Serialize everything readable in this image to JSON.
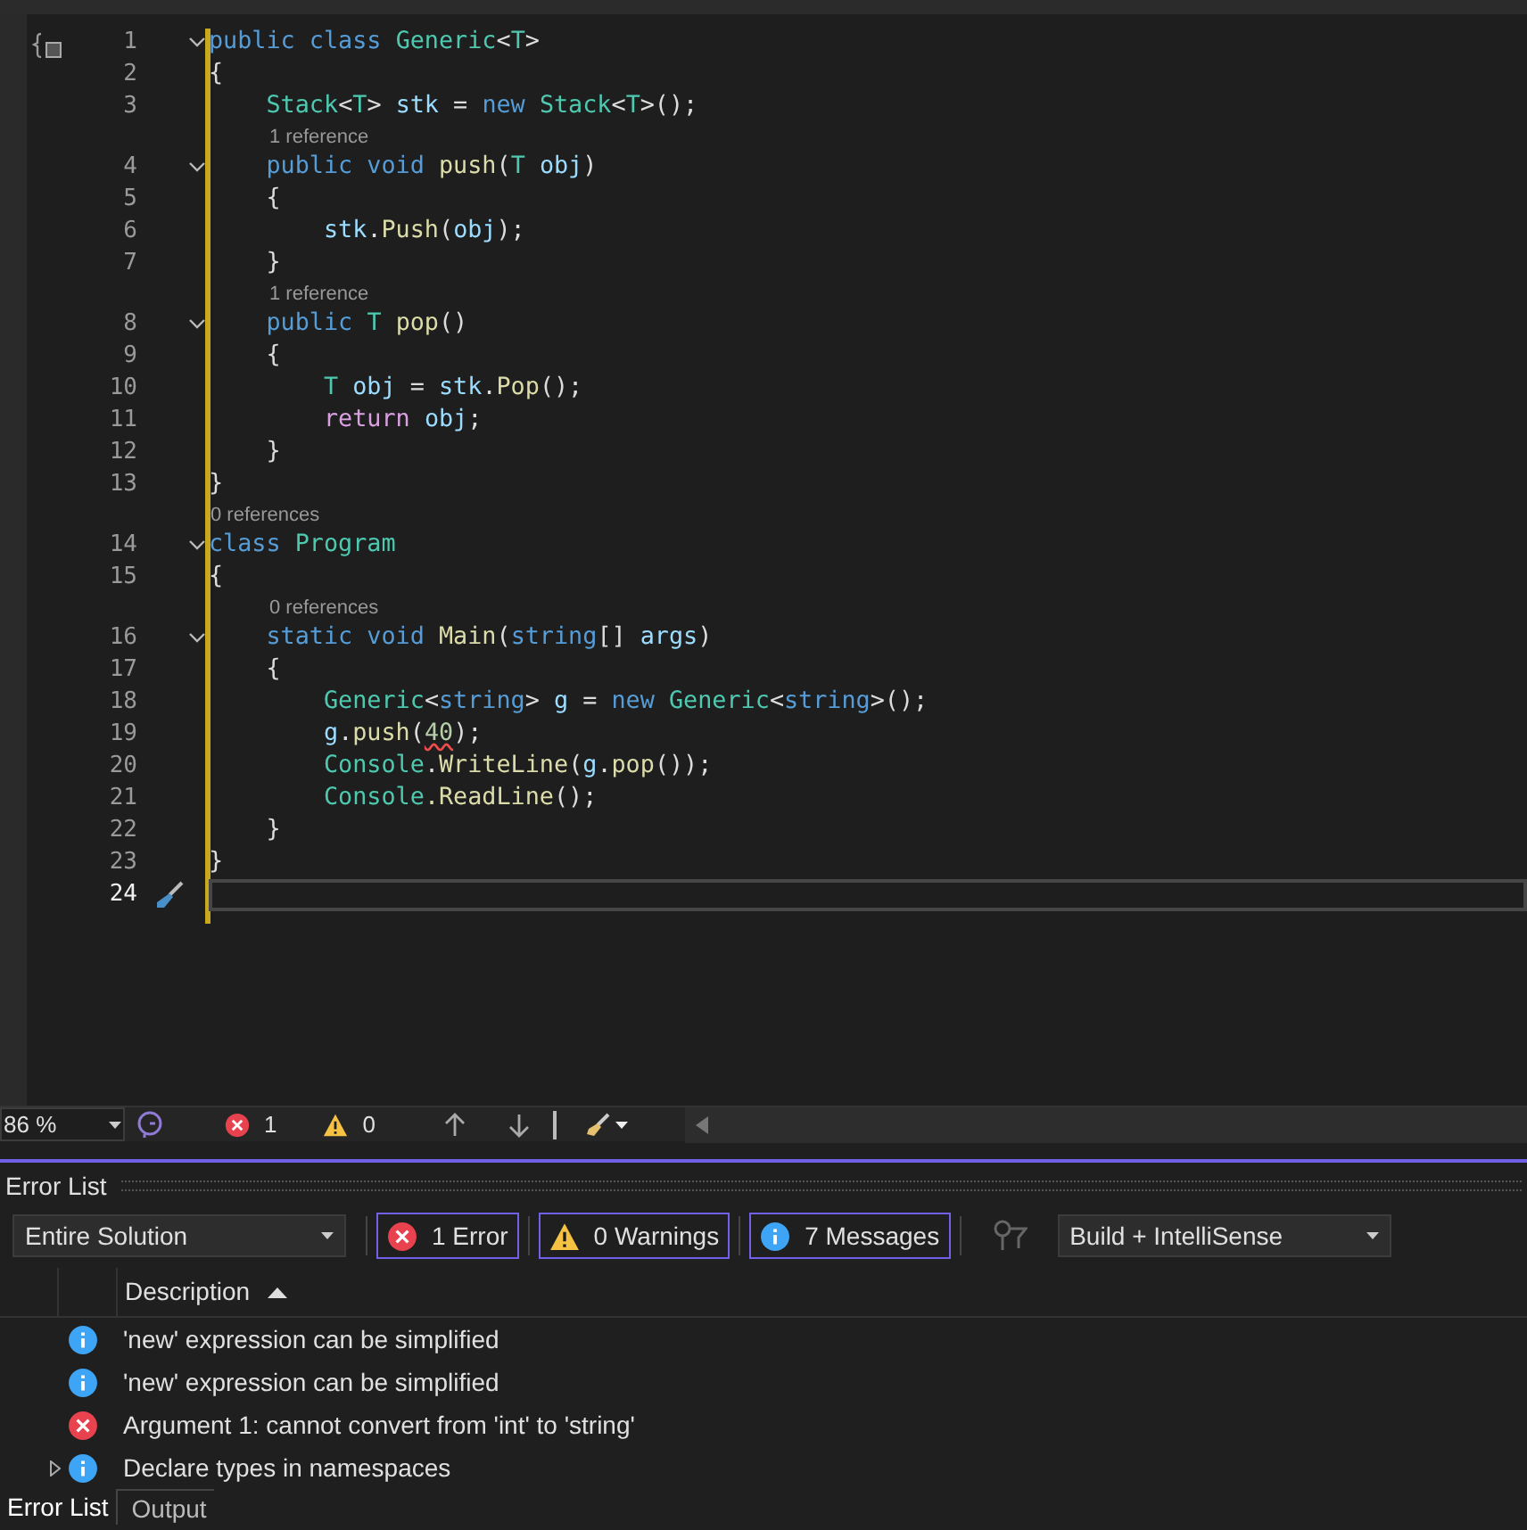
{
  "editor": {
    "lines": [
      {
        "kind": "code",
        "number": "1",
        "fold": true,
        "tokens": [
          {
            "kind": "keyword",
            "text": "public class "
          },
          {
            "kind": "type",
            "text": "Generic"
          },
          {
            "kind": "plain",
            "text": "<"
          },
          {
            "kind": "type",
            "text": "T"
          },
          {
            "kind": "plain",
            "text": ">"
          }
        ]
      },
      {
        "kind": "code",
        "number": "2",
        "fold": false,
        "tokens": [
          {
            "kind": "plain",
            "text": "{"
          }
        ]
      },
      {
        "kind": "code",
        "number": "3",
        "fold": false,
        "tokens": [
          {
            "kind": "type",
            "text": "    Stack"
          },
          {
            "kind": "plain",
            "text": "<"
          },
          {
            "kind": "type",
            "text": "T"
          },
          {
            "kind": "plain",
            "text": "> "
          },
          {
            "kind": "variable",
            "text": "stk"
          },
          {
            "kind": "plain",
            "text": " = "
          },
          {
            "kind": "keyword",
            "text": "new "
          },
          {
            "kind": "type",
            "text": "Stack"
          },
          {
            "kind": "plain",
            "text": "<"
          },
          {
            "kind": "type",
            "text": "T"
          },
          {
            "kind": "plain",
            "text": ">();"
          }
        ]
      },
      {
        "kind": "codelens",
        "text": "1 reference"
      },
      {
        "kind": "code",
        "number": "4",
        "fold": true,
        "tokens": [
          {
            "kind": "keyword",
            "text": "    public void "
          },
          {
            "kind": "method",
            "text": "push"
          },
          {
            "kind": "plain",
            "text": "("
          },
          {
            "kind": "type",
            "text": "T "
          },
          {
            "kind": "variable",
            "text": "obj"
          },
          {
            "kind": "plain",
            "text": ")"
          }
        ]
      },
      {
        "kind": "code",
        "number": "5",
        "fold": false,
        "tokens": [
          {
            "kind": "plain",
            "text": "    {"
          }
        ]
      },
      {
        "kind": "code",
        "number": "6",
        "fold": false,
        "tokens": [
          {
            "kind": "variable",
            "text": "        stk"
          },
          {
            "kind": "plain",
            "text": "."
          },
          {
            "kind": "method",
            "text": "Push"
          },
          {
            "kind": "plain",
            "text": "("
          },
          {
            "kind": "variable",
            "text": "obj"
          },
          {
            "kind": "plain",
            "text": ");"
          }
        ]
      },
      {
        "kind": "code",
        "number": "7",
        "fold": false,
        "tokens": [
          {
            "kind": "plain",
            "text": "    }"
          }
        ]
      },
      {
        "kind": "codelens",
        "text": "1 reference"
      },
      {
        "kind": "code",
        "number": "8",
        "fold": true,
        "tokens": [
          {
            "kind": "keyword",
            "text": "    public "
          },
          {
            "kind": "type",
            "text": "T "
          },
          {
            "kind": "method",
            "text": "pop"
          },
          {
            "kind": "plain",
            "text": "()"
          }
        ]
      },
      {
        "kind": "code",
        "number": "9",
        "fold": false,
        "tokens": [
          {
            "kind": "plain",
            "text": "    {"
          }
        ]
      },
      {
        "kind": "code",
        "number": "10",
        "fold": false,
        "tokens": [
          {
            "kind": "type",
            "text": "        T "
          },
          {
            "kind": "variable",
            "text": "obj"
          },
          {
            "kind": "plain",
            "text": " = "
          },
          {
            "kind": "variable",
            "text": "stk"
          },
          {
            "kind": "plain",
            "text": "."
          },
          {
            "kind": "method",
            "text": "Pop"
          },
          {
            "kind": "plain",
            "text": "();"
          }
        ]
      },
      {
        "kind": "code",
        "number": "11",
        "fold": false,
        "tokens": [
          {
            "kind": "control",
            "text": "        return "
          },
          {
            "kind": "variable",
            "text": "obj"
          },
          {
            "kind": "plain",
            "text": ";"
          }
        ]
      },
      {
        "kind": "code",
        "number": "12",
        "fold": false,
        "tokens": [
          {
            "kind": "plain",
            "text": "    }"
          }
        ]
      },
      {
        "kind": "code",
        "number": "13",
        "fold": false,
        "tokens": [
          {
            "kind": "plain",
            "text": "}"
          }
        ]
      },
      {
        "kind": "codelens",
        "text": "0 references",
        "outdent": true
      },
      {
        "kind": "code",
        "number": "14",
        "fold": true,
        "tokens": [
          {
            "kind": "keyword",
            "text": "class "
          },
          {
            "kind": "type",
            "text": "Program"
          }
        ]
      },
      {
        "kind": "code",
        "number": "15",
        "fold": false,
        "tokens": [
          {
            "kind": "plain",
            "text": "{"
          }
        ]
      },
      {
        "kind": "codelens",
        "text": "0 references"
      },
      {
        "kind": "code",
        "number": "16",
        "fold": true,
        "tokens": [
          {
            "kind": "keyword",
            "text": "    static void "
          },
          {
            "kind": "method",
            "text": "Main"
          },
          {
            "kind": "plain",
            "text": "("
          },
          {
            "kind": "keyword",
            "text": "string"
          },
          {
            "kind": "plain",
            "text": "[] "
          },
          {
            "kind": "variable",
            "text": "args"
          },
          {
            "kind": "plain",
            "text": ")"
          }
        ]
      },
      {
        "kind": "code",
        "number": "17",
        "fold": false,
        "tokens": [
          {
            "kind": "plain",
            "text": "    {"
          }
        ]
      },
      {
        "kind": "code",
        "number": "18",
        "fold": false,
        "tokens": [
          {
            "kind": "type",
            "text": "        Generic"
          },
          {
            "kind": "plain",
            "text": "<"
          },
          {
            "kind": "keyword",
            "text": "string"
          },
          {
            "kind": "plain",
            "text": "> "
          },
          {
            "kind": "variable",
            "text": "g"
          },
          {
            "kind": "plain",
            "text": " = "
          },
          {
            "kind": "keyword",
            "text": "new "
          },
          {
            "kind": "type",
            "text": "Generic"
          },
          {
            "kind": "plain",
            "text": "<"
          },
          {
            "kind": "keyword",
            "text": "string"
          },
          {
            "kind": "plain",
            "text": ">();"
          }
        ]
      },
      {
        "kind": "code",
        "number": "19",
        "fold": false,
        "tokens": [
          {
            "kind": "variable",
            "text": "        g"
          },
          {
            "kind": "plain",
            "text": "."
          },
          {
            "kind": "method",
            "text": "push"
          },
          {
            "kind": "plain",
            "text": "("
          },
          {
            "kind": "error",
            "text": "40"
          },
          {
            "kind": "plain",
            "text": ");"
          }
        ]
      },
      {
        "kind": "code",
        "number": "20",
        "fold": false,
        "tokens": [
          {
            "kind": "type",
            "text": "        Console"
          },
          {
            "kind": "plain",
            "text": "."
          },
          {
            "kind": "method",
            "text": "WriteLine"
          },
          {
            "kind": "plain",
            "text": "("
          },
          {
            "kind": "variable",
            "text": "g"
          },
          {
            "kind": "plain",
            "text": "."
          },
          {
            "kind": "method",
            "text": "pop"
          },
          {
            "kind": "plain",
            "text": "());"
          }
        ]
      },
      {
        "kind": "code",
        "number": "21",
        "fold": false,
        "tokens": [
          {
            "kind": "type",
            "text": "        Console"
          },
          {
            "kind": "method",
            "text": ".ReadLine"
          },
          {
            "kind": "plain",
            "text": "();"
          }
        ]
      },
      {
        "kind": "code",
        "number": "22",
        "fold": false,
        "tokens": [
          {
            "kind": "plain",
            "text": "    }"
          }
        ]
      },
      {
        "kind": "code",
        "number": "23",
        "fold": false,
        "tokens": [
          {
            "kind": "plain",
            "text": "}"
          }
        ]
      },
      {
        "kind": "code",
        "number": "24",
        "fold": false,
        "current": true
      }
    ]
  },
  "editor_status": {
    "zoom": "86 %",
    "errors": "1",
    "warnings": "0"
  },
  "error_list": {
    "title": "Error List",
    "scope": "Entire Solution",
    "filters": [
      {
        "kind": "error",
        "label": "1 Error",
        "selected": true
      },
      {
        "kind": "warning",
        "label": "0 Warnings",
        "selected": true
      },
      {
        "kind": "info",
        "label": "7 Messages",
        "selected": true
      }
    ],
    "source": "Build + IntelliSense",
    "column": "Description",
    "rows": [
      {
        "kind": "info",
        "text": "'new' expression can be simplified",
        "expandable": false
      },
      {
        "kind": "info",
        "text": "'new' expression can be simplified",
        "expandable": false
      },
      {
        "kind": "error",
        "text": "Argument 1: cannot convert from 'int' to 'string'",
        "expandable": false
      },
      {
        "kind": "info",
        "text": "Declare types in namespaces",
        "expandable": true
      }
    ]
  },
  "bottom_tabs": [
    {
      "label": "Error List",
      "selected": true
    },
    {
      "label": "Output",
      "selected": false
    }
  ]
}
